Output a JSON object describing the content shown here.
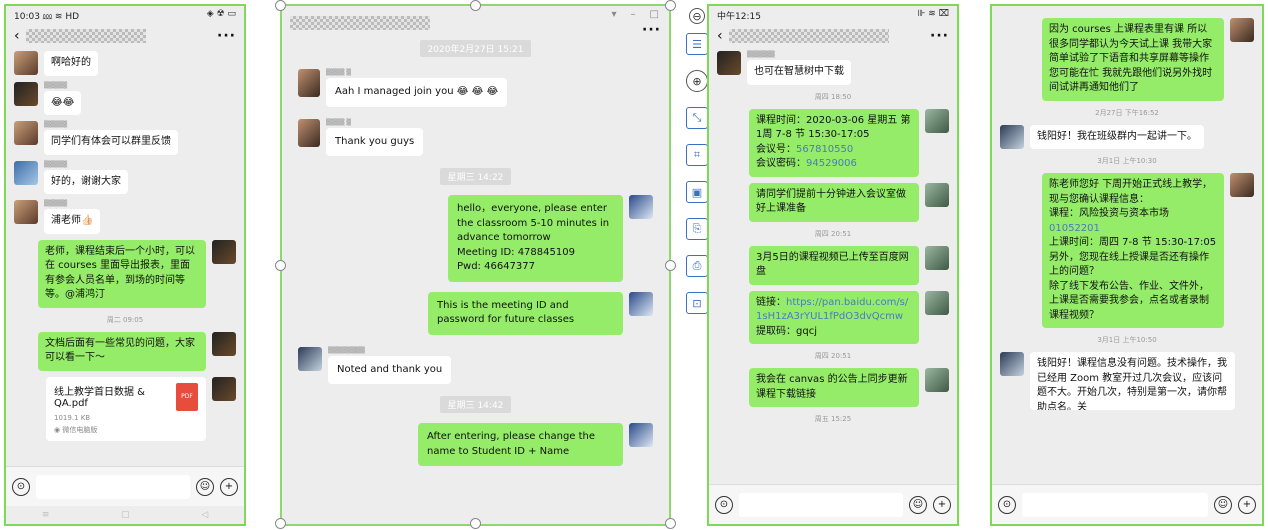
{
  "p1": {
    "status_left": "10:03 ⅏ ≋ HD",
    "status_right": "◈ ☢ ▭",
    "back": "‹",
    "more": "···",
    "msgs": [
      {
        "text": "啊哈好的"
      },
      {
        "text": "😂😂"
      },
      {
        "text": "同学们有体会可以群里反馈"
      },
      {
        "text": "好的，谢谢大家"
      },
      {
        "text": "浦老师👍🏻"
      },
      {
        "text": "老师，课程结束后一个小时，可以在 courses 里面导出报表，里面有参会人员名单，到场的时间等等。@浦鸿汀"
      },
      {
        "text": "文档后面有一些常见的问题，大家可以看一下～"
      }
    ],
    "time1": "周二 09:05",
    "pdf": {
      "name": "线上教学首日数据 & QA.pdf",
      "size": "1019.1 KB",
      "icon": "PDF",
      "source": "◉ 微信电脑版"
    },
    "nav": [
      "≡",
      "▢",
      "◁"
    ]
  },
  "p2": {
    "time1": "2020年2月27日 15:21",
    "msg1": "Aah I managed join you 😂 😂 😂",
    "msg2": "Thank you guys",
    "time2": "星期三 14:22",
    "msg3": "hello，everyone, please enter the classroom 5-10 minutes in advance tomorrow\nMeeting ID:  478845109\nPwd:  46647377",
    "msg4": "This is the meeting ID and password for future classes",
    "msg5": "Noted and thank you",
    "time3": "星期三 14:42",
    "msg6": "After entering, please change the name to Student ID + Name",
    "win_ctl": [
      "▾",
      "–",
      "□"
    ],
    "more": "···"
  },
  "p3": {
    "status_left": "中午12:15",
    "status_right": "⊪ ≋ ⌧",
    "back": "‹",
    "more": "···",
    "msg1": "也可在智慧树中下载",
    "time1": "周四 18:50",
    "msg2_pre": "课程时间：2020-03-06 星期五 第1周 7-8 节 15:30-17:05\n会议号：",
    "msg2_id": "567810550",
    "msg2_mid": "\n会议密码：",
    "msg2_pwd": "94529006",
    "msg3": "请同学们提前十分钟进入会议室做好上课准备",
    "time2": "周四 20:51",
    "msg4": "3月5日的课程视频已上传至百度网盘",
    "msg5_pre": "链接：",
    "msg5_link": "https://pan.baidu.com/s/1sH1zA3rYUL1fPdO3dvQcmw",
    "msg5_post": "\n提取码：gqcj",
    "time3": "周四 20:51",
    "msg6": "我会在 canvas 的公告上同步更新课程下载链接",
    "time4": "周五 15:25",
    "tools": [
      "⊖",
      "☰",
      "⊕",
      "⤡",
      "⌗",
      "▣",
      "⎘",
      "⎙",
      "⊡"
    ]
  },
  "p4": {
    "msg1": "因为 courses 上课程表里有课 所以很多同学都认为今天试上课 我带大家简单试验了下语音和共享屏幕等操作 您可能在忙 我就先跟他们说另外找时间试讲再通知他们了",
    "time1": "2月27日 下午16:52",
    "msg2": "钱阳好！我在班级群内一起讲一下。",
    "time2": "3月1日 上午10:30",
    "msg3_pre": "陈老师您好 下周开始正式线上教学，现与您确认课程信息：\n课程：风险投资与资本市场 ",
    "msg3_code": "01052201",
    "msg3_post": "\n上课时间：周四 7-8 节 15:30-17:05\n另外，您现在线上授课是否还有操作上的问题？\n除了线下发布公告、作业、文件外，上课是否需要我参会，点名或者录制课程视频？",
    "time3": "3月1日 上午10:50",
    "msg4": "钱阳好！课程信息没有问题。技术操作，我已经用 Zoom 教室开过几次会议，应该问题不大。开始几次，特别是第一次，请你帮助点名。关"
  },
  "icons": {
    "voice": "⊙",
    "emoji": "☺",
    "plus": "+"
  }
}
